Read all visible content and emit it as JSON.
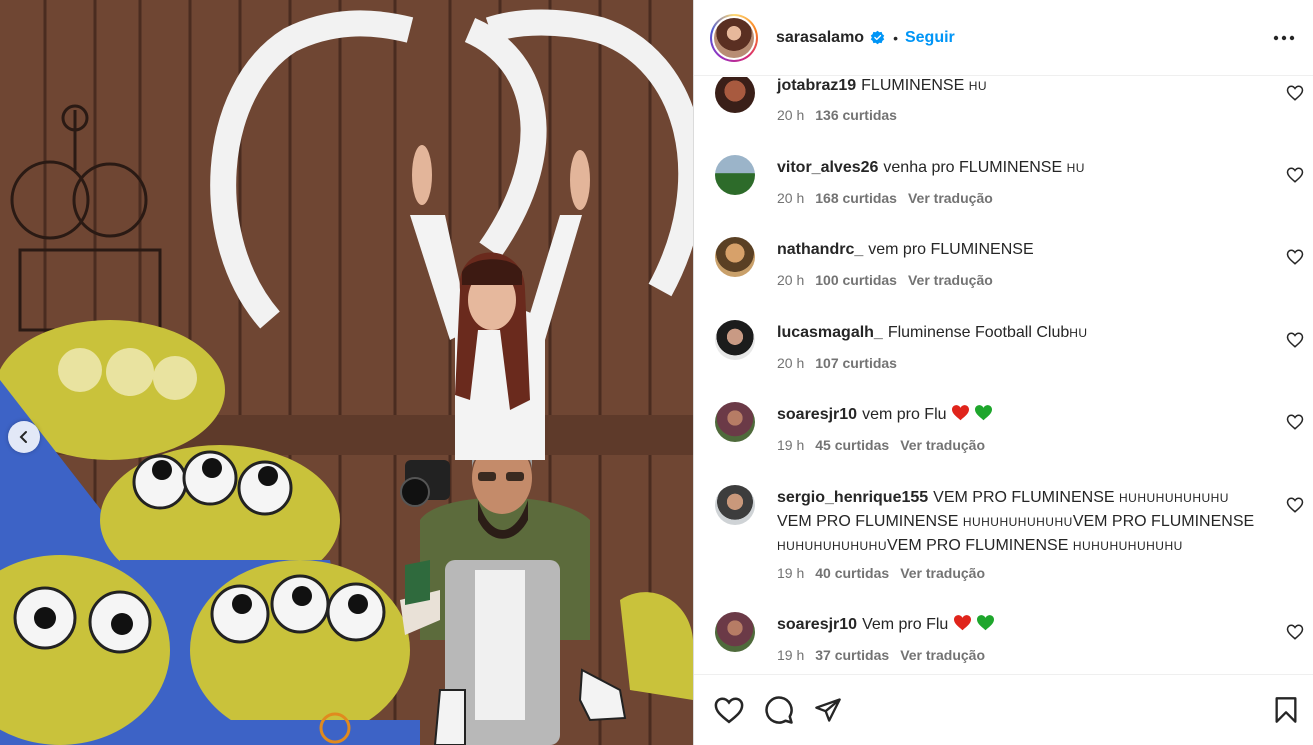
{
  "post": {
    "username": "sarasalamo",
    "separator": "•",
    "follow_label": "Seguir"
  },
  "icons": {
    "verified": "verified-badge-icon",
    "more": "more-options-icon",
    "like": "heart-icon",
    "comment": "comment-icon",
    "share": "share-icon",
    "save": "bookmark-icon",
    "carousel_prev": "chevron-left-icon"
  },
  "colors": {
    "follow": "#0095f6",
    "meta": "#737373",
    "heart_red": "#e0241b",
    "heart_green": "#1ea62c"
  },
  "comments": [
    {
      "user": "jotabraz19",
      "text": "FLUMINENSE ",
      "suffix": "HU",
      "time": "20 h",
      "likes": "136 curtidas",
      "translate": ""
    },
    {
      "user": "vitor_alves26",
      "text": "venha pro FLUMINENSE ",
      "suffix": "HU",
      "time": "20 h",
      "likes": "168 curtidas",
      "translate": "Ver tradução"
    },
    {
      "user": "nathandrc_",
      "text": "vem pro FLUMINENSE",
      "suffix": "",
      "time": "20 h",
      "likes": "100 curtidas",
      "translate": "Ver tradução"
    },
    {
      "user": "lucasmagalh_",
      "text": "Fluminense Football Club",
      "suffix": "HU",
      "time": "20 h",
      "likes": "107 curtidas",
      "translate": ""
    },
    {
      "user": "soaresjr10",
      "text": "vem pro Flu ",
      "suffix": "",
      "time": "19 h",
      "likes": "45 curtidas",
      "translate": "Ver tradução"
    },
    {
      "user": "sergio_henrique155",
      "line1": "VEM PRO FLUMINENSE ",
      "sc1": "HUHUHUHUHUHU",
      "line2": "VEM PRO FLUMINENSE ",
      "sc2": "HUHUHUHUHUHU",
      "line2b": "VEM PRO FLUMINENSE",
      "sc3": "HUHUHUHUHUHU",
      "line3": "VEM PRO FLUMINENSE ",
      "sc4": "HUHUHUHUHUHU",
      "time": "19 h",
      "likes": "40 curtidas",
      "translate": "Ver tradução"
    },
    {
      "user": "soaresjr10",
      "text": "Vem pro Flu ",
      "suffix": "",
      "time": "19 h",
      "likes": "37 curtidas",
      "translate": "Ver tradução"
    }
  ]
}
